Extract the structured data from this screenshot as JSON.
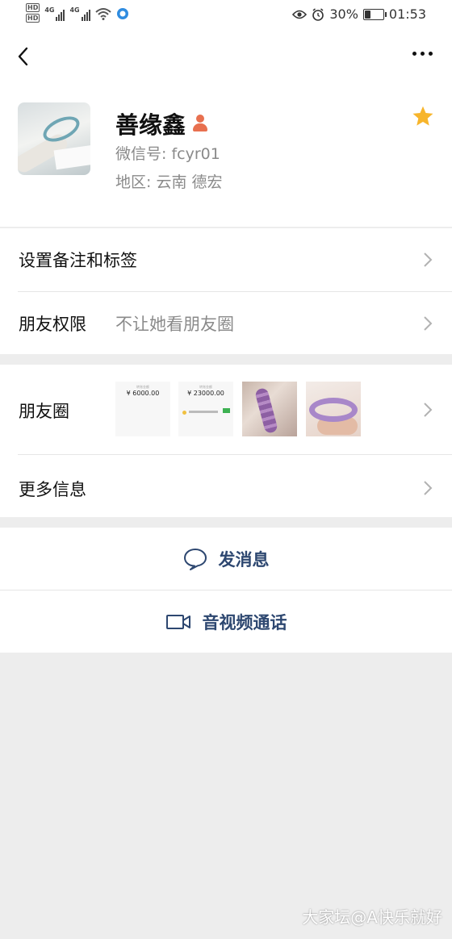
{
  "status_bar": {
    "hd1": "HD",
    "hd2": "HD",
    "net1": "4G",
    "net2": "4G",
    "battery": "30%",
    "battery_level": 0.3,
    "time": "01:53"
  },
  "profile": {
    "name": "善缘鑫",
    "wechat_id": "微信号:  fcyr01",
    "region": "地区:  云南  德宏"
  },
  "rows": {
    "remark_label": "设置备注和标签",
    "permission_label": "朋友权限",
    "permission_value": "不让她看朋友圈",
    "moments_label": "朋友圈",
    "more_info_label": "更多信息"
  },
  "moments_thumbs": [
    {
      "amount": "¥ 6000.00"
    },
    {
      "amount": "¥ 23000.00"
    }
  ],
  "actions": {
    "message": "发消息",
    "call": "音视频通话"
  },
  "watermark": "大家坛@A快乐就好",
  "colors": {
    "accent_text": "#2d4770",
    "star": "#f7b52c",
    "badge": "#e8704f"
  },
  "icons": [
    "back-arrow-icon",
    "more-icon",
    "person-badge-icon",
    "star-icon",
    "chevron-right-icon",
    "chat-bubble-icon",
    "video-camera-icon",
    "eye-icon",
    "alarm-icon",
    "wifi-icon"
  ]
}
